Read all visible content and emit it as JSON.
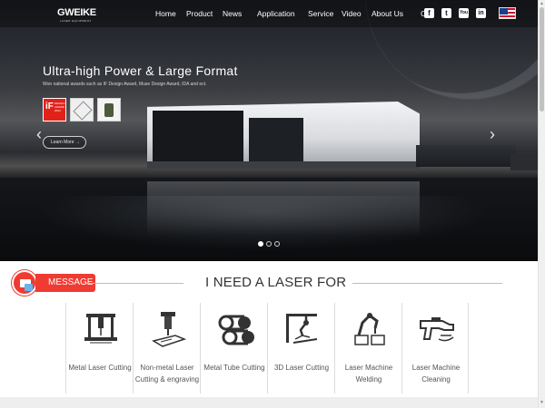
{
  "header": {
    "logo": "GWEIKE",
    "logo_sub": "LASER EQUIPMENT",
    "nav": [
      "Home",
      "Product",
      "News",
      "Application",
      "Service",
      "Video",
      "About Us"
    ],
    "contact_partial": "C",
    "social": [
      {
        "icon": "facebook-icon",
        "glyph": "f"
      },
      {
        "icon": "twitter-icon",
        "glyph": "t"
      },
      {
        "icon": "youtube-icon",
        "glyph": "You"
      },
      {
        "icon": "linkedin-icon",
        "glyph": "in"
      }
    ],
    "language_icon": "us-flag-icon"
  },
  "hero": {
    "title": "Ultra-high Power & Large Format",
    "subtitle": "Won national awards such as IF Design Award, Muse Design Award, IDA and ect.",
    "awards": [
      {
        "name": "if-design-award-badge",
        "text": "iF",
        "note": "DESIGN AWARD 2024"
      },
      {
        "name": "muse-design-award-badge"
      },
      {
        "name": "ida-award-badge"
      }
    ],
    "learn_more": "Learn More  →",
    "slides": 3,
    "active_slide": 1,
    "prev_glyph": "‹",
    "next_glyph": "›"
  },
  "message": {
    "label": "MESSAGE"
  },
  "section": {
    "title": "I NEED A LASER FOR",
    "items": [
      {
        "label": "Metal Laser Cutting",
        "icon": "metal-laser-cutting-icon"
      },
      {
        "label": "Non-metal Laser Cutting & engraving",
        "icon": "non-metal-laser-icon"
      },
      {
        "label": "Metal Tube Cutting",
        "icon": "metal-tube-icon"
      },
      {
        "label": "3D Laser Cutting",
        "icon": "3d-laser-cutting-icon"
      },
      {
        "label": "Laser Machine Welding",
        "icon": "laser-welding-icon"
      },
      {
        "label": "Laser Machine Cleaning",
        "icon": "laser-cleaning-icon"
      }
    ]
  },
  "colors": {
    "accent": "#ef3b32",
    "title_text": "#333333"
  }
}
